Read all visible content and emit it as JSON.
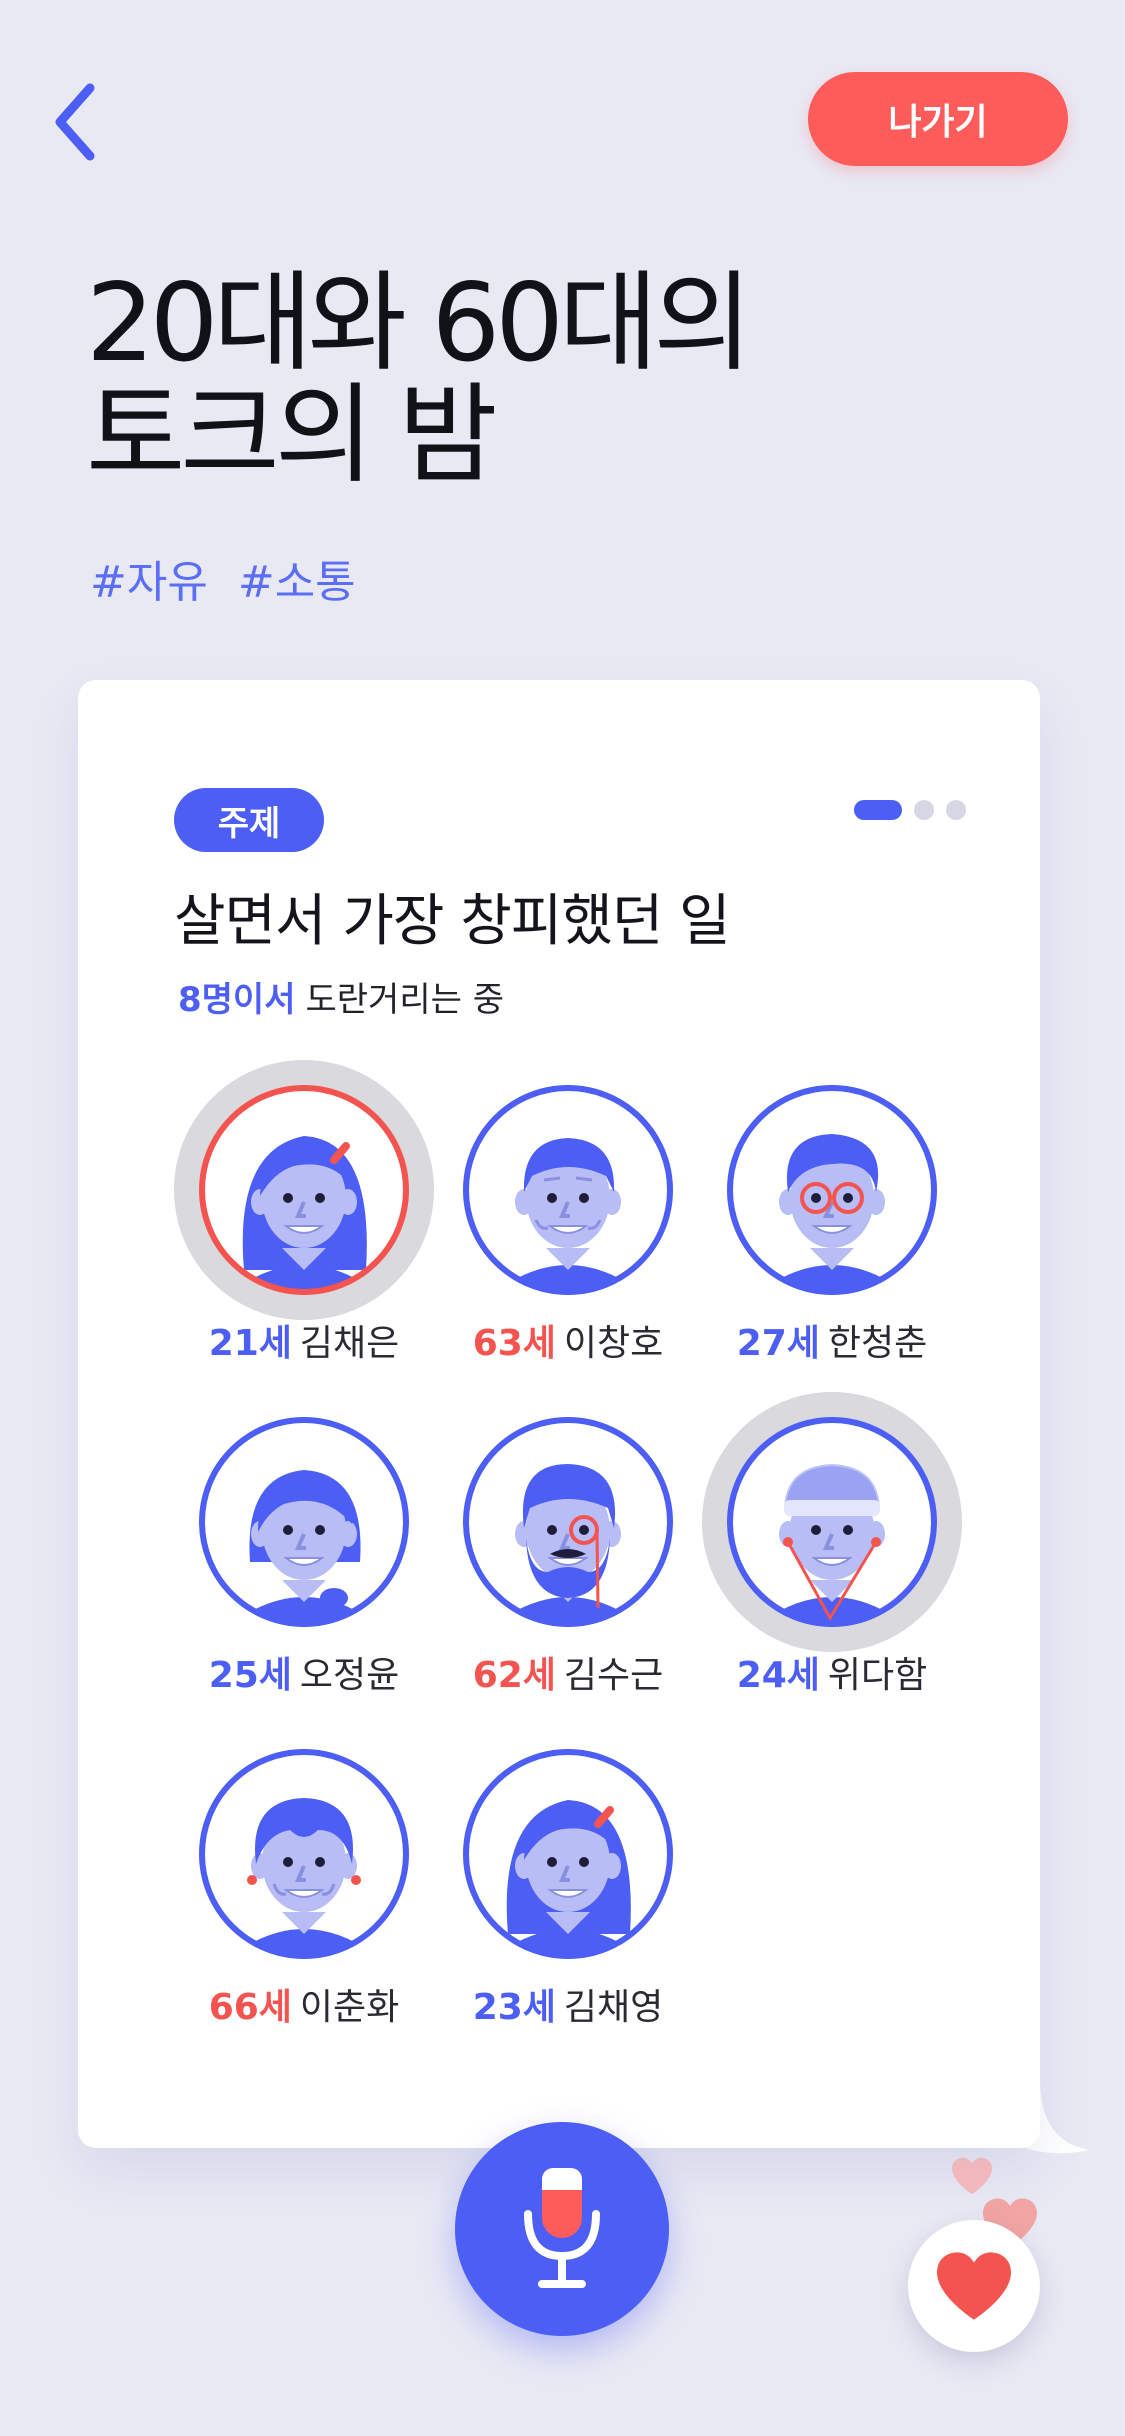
{
  "header": {
    "back_icon": "chevron-left-icon",
    "exit_label": "나가기"
  },
  "room": {
    "title_line1": "20대와 60대의",
    "title_line2": "토크의 밤",
    "tags": [
      "#자유",
      "#소통"
    ]
  },
  "topic": {
    "badge": "주제",
    "title": "살면서 가장 창피했던 일",
    "participants_count": "8명이서",
    "participants_suffix": "도란거리는 중",
    "page_total": 3,
    "page_current": 1
  },
  "members": [
    {
      "age": "21세",
      "name": "김채은",
      "age_color": "blue",
      "speaking": true,
      "avatar": "woman-long-hair-avatar"
    },
    {
      "age": "63세",
      "name": "이창호",
      "age_color": "red",
      "speaking": false,
      "avatar": "older-man-avatar"
    },
    {
      "age": "27세",
      "name": "한청춘",
      "age_color": "blue",
      "speaking": false,
      "avatar": "man-glasses-avatar"
    },
    {
      "age": "25세",
      "name": "오정윤",
      "age_color": "blue",
      "speaking": false,
      "avatar": "woman-braid-avatar"
    },
    {
      "age": "62세",
      "name": "김수근",
      "age_color": "red",
      "speaking": false,
      "avatar": "bearded-man-monocle-avatar"
    },
    {
      "age": "24세",
      "name": "위다함",
      "age_color": "blue",
      "speaking": true,
      "avatar": "man-cap-earphones-avatar"
    },
    {
      "age": "66세",
      "name": "이춘화",
      "age_color": "red",
      "speaking": false,
      "avatar": "older-woman-avatar"
    },
    {
      "age": "23세",
      "name": "김채영",
      "age_color": "blue",
      "speaking": false,
      "avatar": "woman-hairpin-avatar"
    }
  ],
  "controls": {
    "mic_icon": "microphone-icon",
    "like_icon": "heart-icon"
  },
  "colors": {
    "accent": "#4c5ef4",
    "alert": "#fd5c5a",
    "background": "#e9e9f4"
  }
}
